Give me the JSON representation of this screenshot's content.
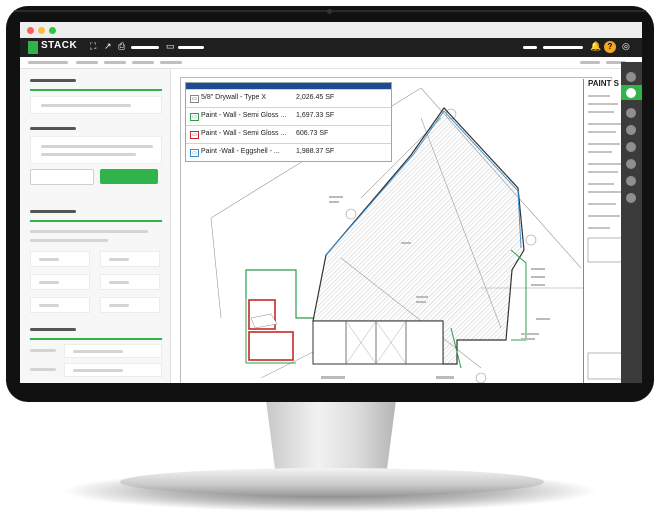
{
  "app": {
    "name": "STACK",
    "brand_color": "#2fb34a"
  },
  "window": {
    "controls": [
      "close",
      "minimize",
      "maximize"
    ],
    "control_colors": [
      "#ff5f57",
      "#febc2e",
      "#28c840"
    ]
  },
  "appbar": {
    "icons": [
      "expand-icon",
      "external-link-icon",
      "print-icon",
      "file-icon",
      "bell-icon",
      "help-icon",
      "user-icon"
    ]
  },
  "drawing": {
    "title_block_heading": "PAINT S",
    "legend": [
      {
        "name": "5/8\" Drywall - Type X",
        "quantity": "2,026.45 SF",
        "color": "#888888"
      },
      {
        "name": "Paint - Wall - Semi Gloss ...",
        "quantity": "1,697.33 SF",
        "color": "#2e9e4e"
      },
      {
        "name": "Paint - Wall - Semi Gloss ...",
        "quantity": "606.73 SF",
        "color": "#c62828"
      },
      {
        "name": "Paint -Wall - Eggshell - ...",
        "quantity": "1,988.37 SF",
        "color": "#3a8fd1"
      }
    ]
  }
}
